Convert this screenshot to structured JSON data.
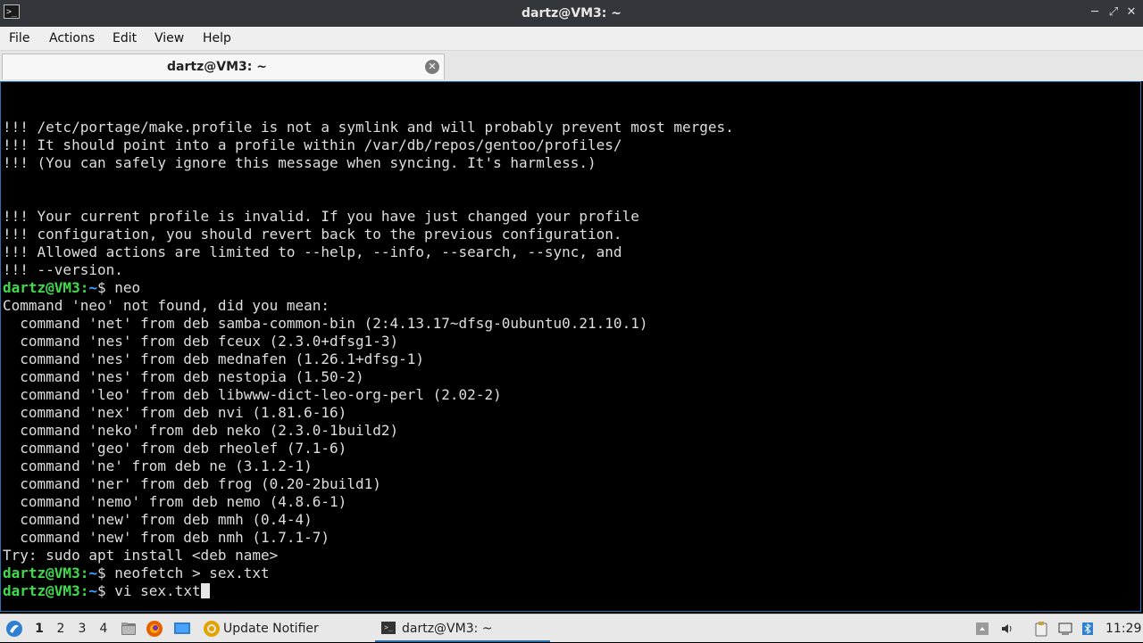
{
  "window": {
    "title": "dartz@VM3: ~",
    "controls": {
      "minimize": "─",
      "maximize": "⤢",
      "close": "✕"
    },
    "app_icon": ">_"
  },
  "menu": [
    "File",
    "Actions",
    "Edit",
    "View",
    "Help"
  ],
  "tab": {
    "label": "dartz@VM3: ~",
    "close": "✕"
  },
  "terminal": {
    "lines": [
      {
        "text": "!!! /etc/portage/make.profile is not a symlink and will probably prevent most merges."
      },
      {
        "text": "!!! It should point into a profile within /var/db/repos/gentoo/profiles/"
      },
      {
        "text": "!!! (You can safely ignore this message when syncing. It's harmless.)"
      },
      {
        "text": ""
      },
      {
        "text": ""
      },
      {
        "text": "!!! Your current profile is invalid. If you have just changed your profile"
      },
      {
        "text": "!!! configuration, you should revert back to the previous configuration."
      },
      {
        "text": "!!! Allowed actions are limited to --help, --info, --search, --sync, and"
      },
      {
        "text": "!!! --version."
      },
      {
        "user": "dartz@VM3",
        "path": "~",
        "cmd": "neo"
      },
      {
        "text": "Command 'neo' not found, did you mean:"
      },
      {
        "text": "  command 'net' from deb samba-common-bin (2:4.13.17~dfsg-0ubuntu0.21.10.1)"
      },
      {
        "text": "  command 'nes' from deb fceux (2.3.0+dfsg1-3)"
      },
      {
        "text": "  command 'nes' from deb mednafen (1.26.1+dfsg-1)"
      },
      {
        "text": "  command 'nes' from deb nestopia (1.50-2)"
      },
      {
        "text": "  command 'leo' from deb libwww-dict-leo-org-perl (2.02-2)"
      },
      {
        "text": "  command 'nex' from deb nvi (1.81.6-16)"
      },
      {
        "text": "  command 'neko' from deb neko (2.3.0-1build2)"
      },
      {
        "text": "  command 'geo' from deb rheolef (7.1-6)"
      },
      {
        "text": "  command 'ne' from deb ne (3.1.2-1)"
      },
      {
        "text": "  command 'ner' from deb frog (0.20-2build1)"
      },
      {
        "text": "  command 'nemo' from deb nemo (4.8.6-1)"
      },
      {
        "text": "  command 'new' from deb mmh (0.4-4)"
      },
      {
        "text": "  command 'new' from deb nmh (1.7.1-7)"
      },
      {
        "text": "Try: sudo apt install <deb name>"
      },
      {
        "user": "dartz@VM3",
        "path": "~",
        "cmd": "neofetch > sex.txt"
      },
      {
        "user": "dartz@VM3",
        "path": "~",
        "cmd": "vi sex.txt",
        "cursor": true
      }
    ]
  },
  "taskbar": {
    "workspaces": [
      "1",
      "2",
      "3",
      "4"
    ],
    "active_workspace": "1",
    "launchers": [
      "start-menu-icon",
      "file-manager-icon",
      "firefox-icon",
      "desktop-icon"
    ],
    "tasks": [
      {
        "label": "Update Notifier",
        "icon": "update-notifier-icon"
      },
      {
        "label": "dartz@VM3: ~",
        "icon": "terminal-icon",
        "active": true
      }
    ],
    "tray": [
      "tray-arrow-icon",
      "volume-icon",
      "clipboard-icon",
      "screen-icon",
      "bluetooth-icon"
    ],
    "clock": "11:29",
    "colors": {
      "accent": "#2a6fb0",
      "prompt_user": "#3edc4a",
      "prompt_path": "#4aa3ff"
    }
  }
}
